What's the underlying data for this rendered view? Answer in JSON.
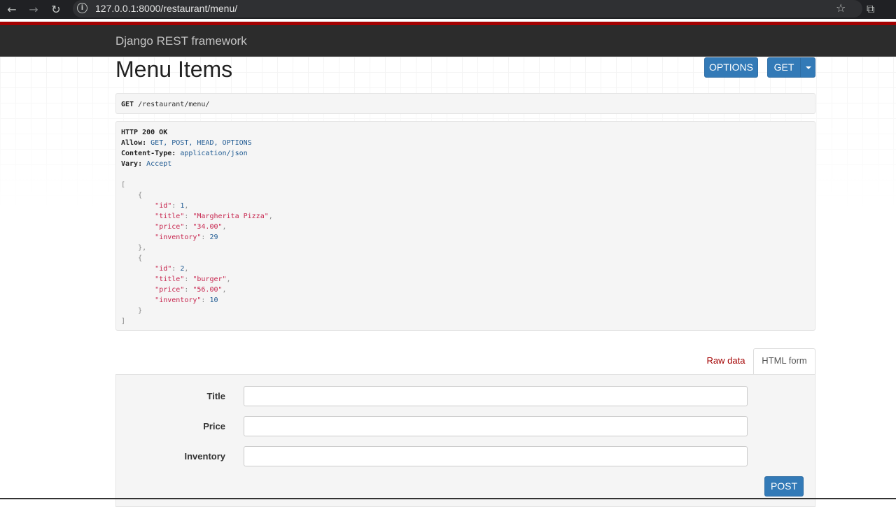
{
  "browser": {
    "url": "127.0.0.1:8000/restaurant/menu/",
    "back_glyph": "←",
    "forward_glyph": "→",
    "reload_glyph": "↻",
    "info_glyph": "i",
    "star_glyph": "☆",
    "ext_glyph": "⧉"
  },
  "navbar": {
    "brand": "Django REST framework"
  },
  "page": {
    "title": "Menu Items"
  },
  "buttons": {
    "options": "OPTIONS",
    "get": "GET",
    "post": "POST"
  },
  "request": {
    "method": "GET",
    "path": "/restaurant/menu/"
  },
  "response": {
    "status": "HTTP 200 OK",
    "headers": [
      {
        "name": "Allow:",
        "value": "GET, POST, HEAD, OPTIONS"
      },
      {
        "name": "Content-Type:",
        "value": "application/json"
      },
      {
        "name": "Vary:",
        "value": "Accept"
      }
    ],
    "items": [
      {
        "id": "1",
        "title": "\"Margherita Pizza\"",
        "price": "\"34.00\"",
        "inventory": "29"
      },
      {
        "id": "2",
        "title": "\"burger\"",
        "price": "\"56.00\"",
        "inventory": "10"
      }
    ],
    "keys": {
      "id": "\"id\"",
      "title": "\"title\"",
      "price": "\"price\"",
      "inventory": "\"inventory\""
    }
  },
  "tabs": {
    "raw": "Raw data",
    "html": "HTML form"
  },
  "form": {
    "fields": [
      {
        "label": "Title",
        "value": ""
      },
      {
        "label": "Price",
        "value": ""
      },
      {
        "label": "Inventory",
        "value": ""
      }
    ]
  },
  "colors": {
    "accent": "#337ab7",
    "brand_red": "#a30000",
    "navbar": "#2c2c2c"
  }
}
